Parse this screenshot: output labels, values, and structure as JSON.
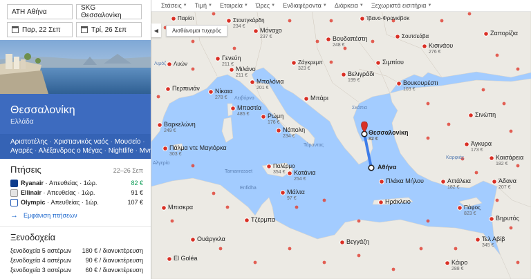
{
  "search": {
    "from": "ATH Αθήνα",
    "to": "SKG Θεσσαλονίκη",
    "depart": "Παρ, 22 Σεπ",
    "return": "Τρί, 26 Σεπ"
  },
  "destination": {
    "city": "Θεσσαλονίκη",
    "country": "Ελλάδα",
    "tags": [
      "Αριστοτέλης",
      "Χριστιανικός ναός",
      "Μουσείο",
      "Αγαρές",
      "Αλέξανδρος ο Μέγας",
      "Nightlife",
      "Μνημείο"
    ]
  },
  "flights": {
    "title": "Πτήσεις",
    "dates": "22–26 Σεπ",
    "rows": [
      {
        "airline": "Ryanair",
        "detail": "· Απευθείας · 1ώρ.",
        "price": "82 €",
        "color": "#0f3d8c"
      },
      {
        "airline": "Ellinair",
        "detail": "· Απευθείας · 1ώρ.",
        "price": "91 €",
        "color": "#888888"
      },
      {
        "airline": "Olympic",
        "detail": "· Απευθείας · 1ώρ.",
        "price": "107 €",
        "color": "#2a60b8"
      }
    ],
    "show": "Εμφάνιση πτήσεων"
  },
  "hotels": {
    "title": "Ξενοδοχεία",
    "rows": [
      {
        "label": "ξενοδοχεία 5 αστέρων",
        "price": "180 € / διανυκτέρευση"
      },
      {
        "label": "ξενοδοχεία 4 αστέρων",
        "price": "90 € / διανυκτέρευση"
      },
      {
        "label": "ξενοδοχεία 3 αστέρων",
        "price": "60 € / διανυκτέρευση"
      }
    ]
  },
  "filters": [
    "Στάσεις",
    "Τιμή",
    "Εταιρεία",
    "Ώρες",
    "Ενδιαφέροντα",
    "Διάρκεια",
    "Ξεχωριστά εισιτήρια"
  ],
  "map": {
    "lucky": "Αισθάνομαι τυχερός",
    "origin": {
      "name": "Αθήνα"
    },
    "target": {
      "name": "Θεσσαλονίκη",
      "price": "82 €"
    },
    "cities": [
      {
        "name": "Παρίσι",
        "price": ""
      },
      {
        "name": "Στουτγκάρδη",
        "price": "234 €"
      },
      {
        "name": "Ίβανο-Φρανκίβσκ",
        "price": ""
      },
      {
        "name": "Μόναχο",
        "price": "237 €"
      },
      {
        "name": "Βουδαπέστη",
        "price": "248 €"
      },
      {
        "name": "Σουτσεάβα",
        "price": ""
      },
      {
        "name": "Ζαπορίζια",
        "price": ""
      },
      {
        "name": "Γενεύη",
        "price": "211 €"
      },
      {
        "name": "Ζάγκρεμπ",
        "price": "323 €"
      },
      {
        "name": "Κισινάου",
        "price": "276 €"
      },
      {
        "name": "Λυών",
        "price": ""
      },
      {
        "name": "Μιλάνο",
        "price": "211 €"
      },
      {
        "name": "Βελιγράδι",
        "price": "199 €"
      },
      {
        "name": "Σιμπίου",
        "price": ""
      },
      {
        "name": "Μπολόνια",
        "price": "201 €"
      },
      {
        "name": "Βουκουρέστι",
        "price": "103 €"
      },
      {
        "name": "Νίκαια",
        "price": "278 €"
      },
      {
        "name": "Μπάρι",
        "price": ""
      },
      {
        "name": "Περπινιάν",
        "price": ""
      },
      {
        "name": "Μπαστία",
        "price": "485 €"
      },
      {
        "name": "Ρώμη",
        "price": "176 €"
      },
      {
        "name": "Σινώπη",
        "price": ""
      },
      {
        "name": "Βαρκελώνη",
        "price": "249 €"
      },
      {
        "name": "Νάπολη",
        "price": "234 €"
      },
      {
        "name": "Πάλμα ντε Μαγιόρκα",
        "price": "303 €"
      },
      {
        "name": "Άγκυρα",
        "price": "173 €"
      },
      {
        "name": "Καισάρεια",
        "price": "182 €"
      },
      {
        "name": "Παλέρμο",
        "price": "354 €"
      },
      {
        "name": "Κατάνια",
        "price": "254 €"
      },
      {
        "name": "Πλάκα Μήλου",
        "price": ""
      },
      {
        "name": "Αττάλεια",
        "price": "182 €"
      },
      {
        "name": "Άδανα",
        "price": "207 €"
      },
      {
        "name": "Μάλτα",
        "price": "97 €"
      },
      {
        "name": "Ηράκλειο",
        "price": ""
      },
      {
        "name": "Πάφος",
        "price": "823 €"
      },
      {
        "name": "Μπισκρα",
        "price": ""
      },
      {
        "name": "Τζέρμπα",
        "price": ""
      },
      {
        "name": "Βηρυτός",
        "price": ""
      },
      {
        "name": "Ουάργκλα",
        "price": ""
      },
      {
        "name": "Βεγγάζη",
        "price": ""
      },
      {
        "name": "Τελ Αβίβ",
        "price": "345 €"
      },
      {
        "name": "El Goléa",
        "price": ""
      },
      {
        "name": "Κάιρο",
        "price": "288 €"
      }
    ],
    "places": [
      "Λειβόρνο",
      "Λιμόζ",
      "Τάραντας",
      "Tamanrasset",
      "Enfidha",
      "Αλγερία",
      "Καρφιάς",
      "Σκόπια"
    ]
  }
}
